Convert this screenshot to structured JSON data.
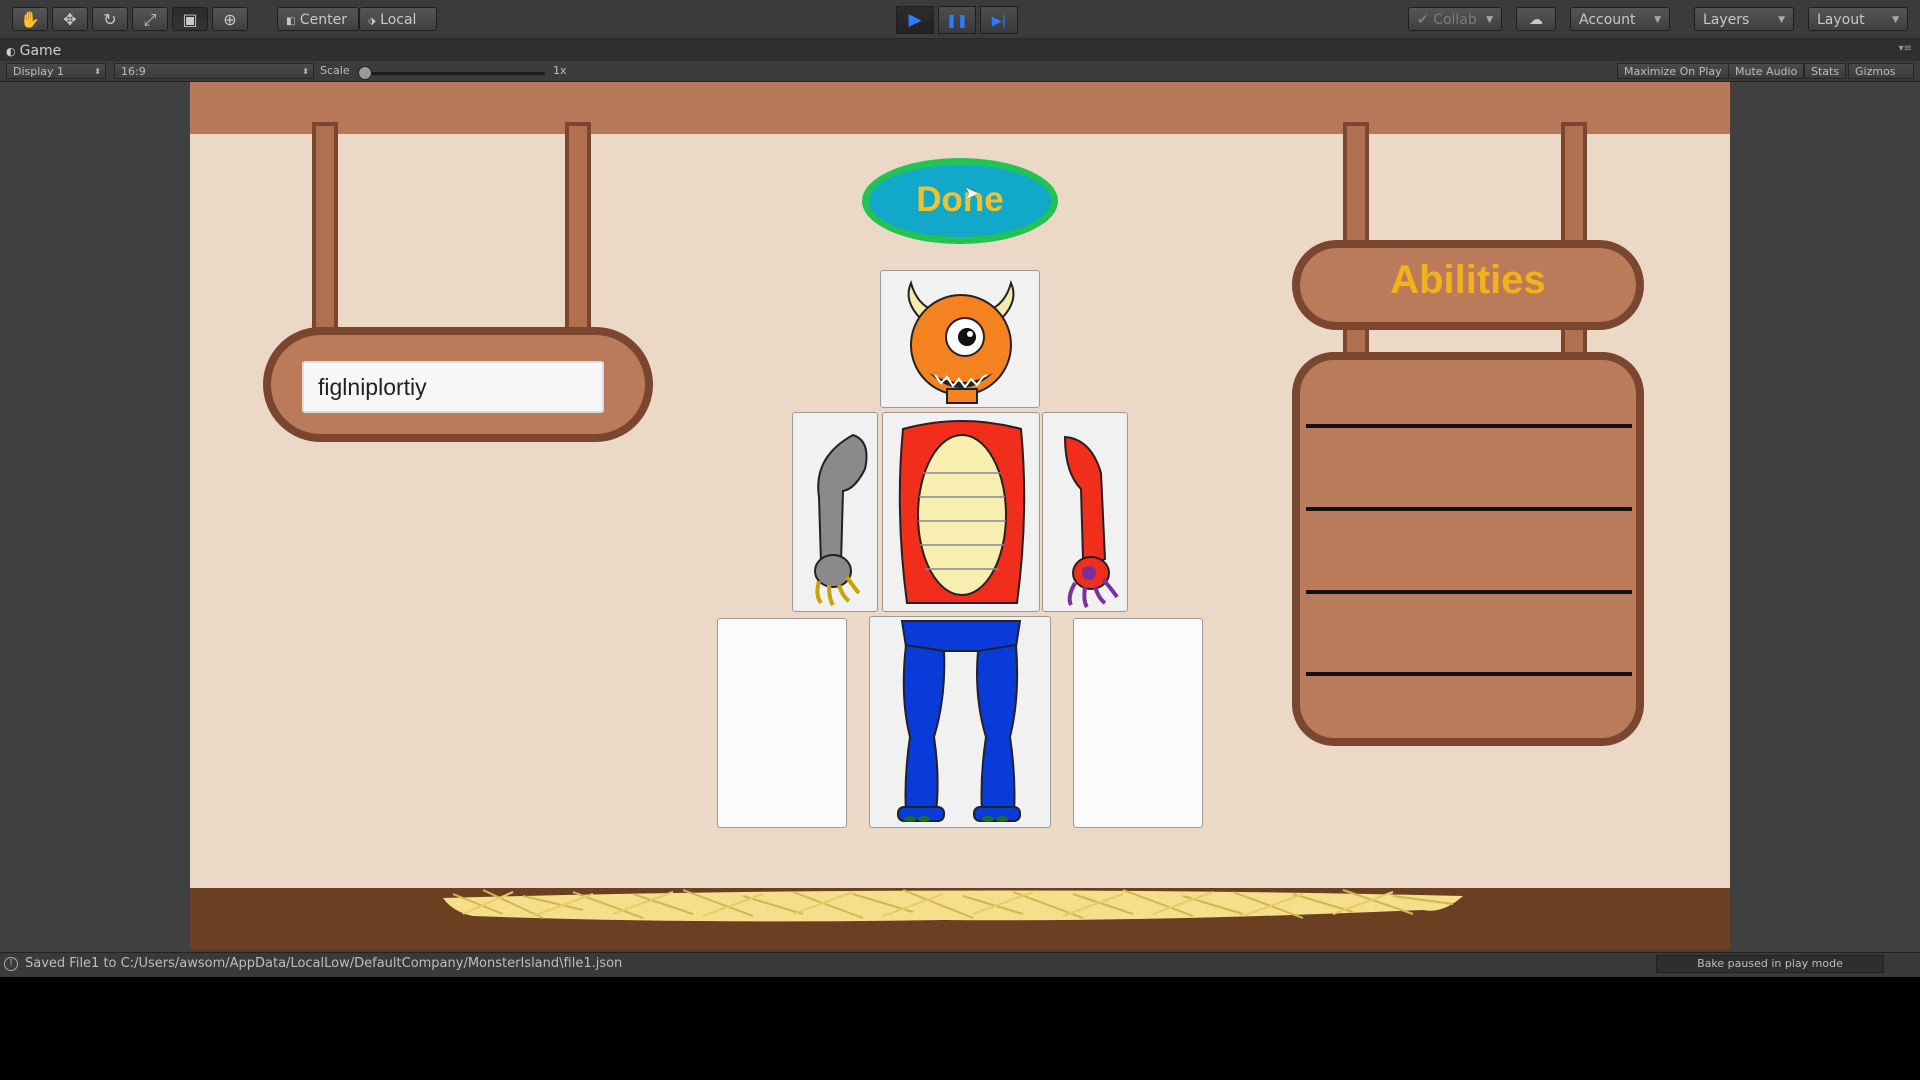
{
  "toolbar": {
    "tools": [
      {
        "name": "hand-tool-icon",
        "glyph": "✋"
      },
      {
        "name": "move-tool-icon",
        "glyph": "✥"
      },
      {
        "name": "rotate-tool-icon",
        "glyph": "↻"
      },
      {
        "name": "scale-tool-icon",
        "glyph": "⤢"
      },
      {
        "name": "rect-tool-icon",
        "glyph": "▣"
      },
      {
        "name": "transform-tool-icon",
        "glyph": "⊕"
      }
    ],
    "pivot_label": "Center",
    "space_label": "Local",
    "collab_label": "Collab",
    "account_label": "Account",
    "layers_label": "Layers",
    "layout_label": "Layout",
    "play_glyph": "▶",
    "pause_glyph": "❚❚",
    "step_glyph": "▶|"
  },
  "game_tab": {
    "label": "Game",
    "display": "Display 1",
    "aspect": "16:9",
    "scale_label": "Scale",
    "scale_value": "1x",
    "maximize_on_play": "Maximize On Play",
    "mute_audio": "Mute Audio",
    "stats": "Stats",
    "gizmos": "Gizmos"
  },
  "game": {
    "monster_name": "figlniplortiy",
    "done_label": "Done",
    "abilities_title": "Abilities"
  },
  "status": {
    "message": "Saved File1 to C:/Users/awsom/AppData/LocalLow/DefaultCompany/MonsterIsland\\file1.json",
    "bake": "Bake paused in play mode"
  }
}
